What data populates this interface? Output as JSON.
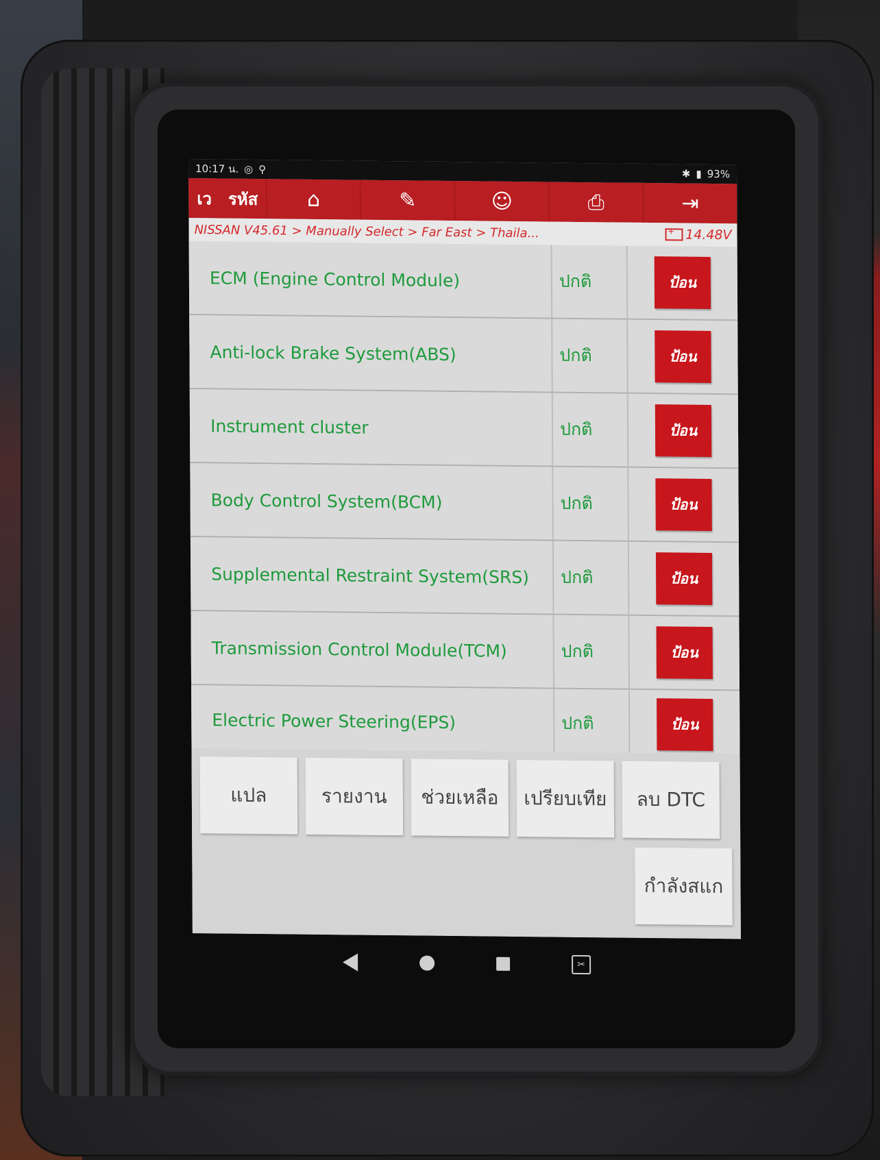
{
  "status_bar": {
    "time": "10:17 น.",
    "battery": "93%"
  },
  "toolbar": {
    "back_label": "เว",
    "code_label": "รหัส",
    "icons": [
      "home-icon",
      "edit-icon",
      "user-icon",
      "printer-icon",
      "exit-icon"
    ]
  },
  "breadcrumb": {
    "path": "NISSAN V45.61 > Manually Select > Far East > Thaila...",
    "voltage": "14.48V"
  },
  "systems": [
    {
      "name": "ECM (Engine Control Module)",
      "status": "ปกติ",
      "action": "ป้อน"
    },
    {
      "name": "Anti-lock Brake System(ABS)",
      "status": "ปกติ",
      "action": "ป้อน"
    },
    {
      "name": "Instrument cluster",
      "status": "ปกติ",
      "action": "ป้อน"
    },
    {
      "name": "Body Control System(BCM)",
      "status": "ปกติ",
      "action": "ป้อน"
    },
    {
      "name": "Supplemental Restraint System(SRS)",
      "status": "ปกติ",
      "action": "ป้อน"
    },
    {
      "name": "Transmission Control Module(TCM)",
      "status": "ปกติ",
      "action": "ป้อน"
    },
    {
      "name": "Electric Power Steering(EPS)",
      "status": "ปกติ",
      "action": "ป้อน"
    }
  ],
  "functions": {
    "translate": "แปล",
    "report": "รายงาน",
    "help": "ช่วยเหลือ",
    "compare": "เปรียบเทีย",
    "clear_dtc": "ลบ DTC",
    "scanning": "กำลังสแก"
  },
  "colors": {
    "accent_red": "#b81e22",
    "status_green": "#1e9a3c",
    "panel_gray": "#d8d8d8"
  }
}
